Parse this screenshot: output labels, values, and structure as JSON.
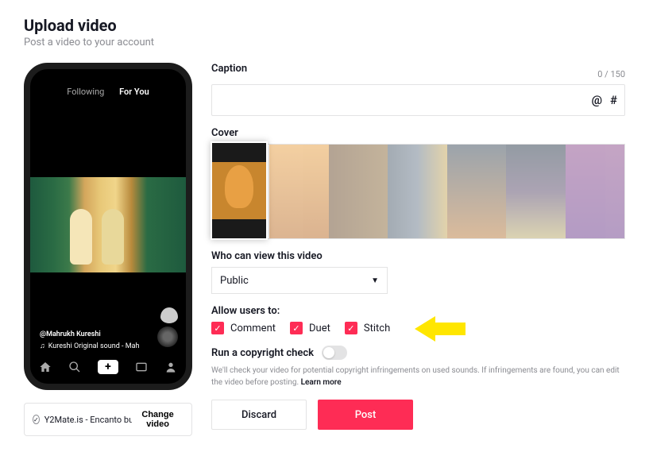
{
  "header": {
    "title": "Upload video",
    "subtitle": "Post a video to your account"
  },
  "phone": {
    "tabs": {
      "following": "Following",
      "forYou": "For You"
    },
    "author": "@Mahrukh Kureshi",
    "sound": "Kureshi Original sound - Mah"
  },
  "file": {
    "name": "Y2Mate.is - Encanto bu...",
    "changeLabel": "Change video"
  },
  "caption": {
    "label": "Caption",
    "count": "0",
    "max": "150",
    "atSymbol": "@",
    "hashSymbol": "#"
  },
  "cover": {
    "label": "Cover"
  },
  "visibility": {
    "label": "Who can view this video",
    "selected": "Public"
  },
  "permissions": {
    "label": "Allow users to:",
    "items": [
      "Comment",
      "Duet",
      "Stitch"
    ]
  },
  "copyright": {
    "label": "Run a copyright check",
    "note1": "We'll check your video for potential copyright infringements on used sounds. If infringements are found, you can edit the video before posting. ",
    "learn": "Learn more"
  },
  "actions": {
    "discard": "Discard",
    "post": "Post"
  }
}
